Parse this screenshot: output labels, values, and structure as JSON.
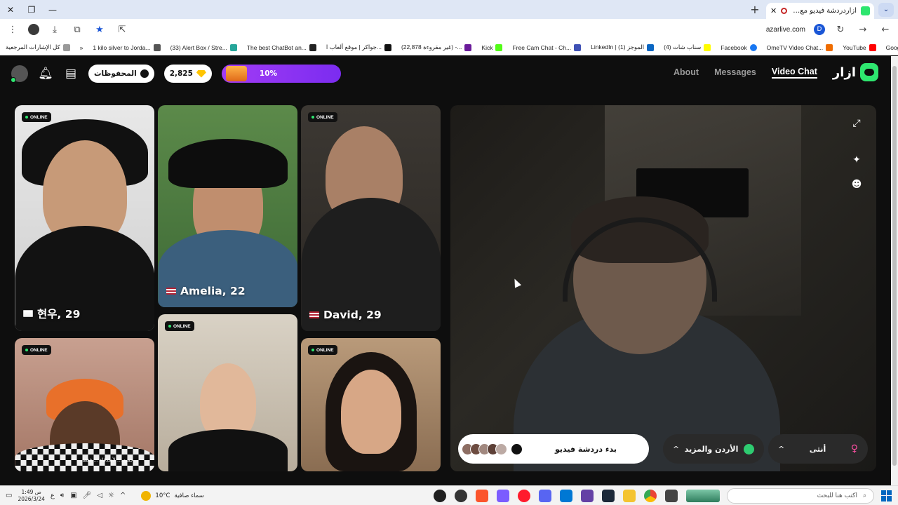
{
  "browser": {
    "window_controls": {
      "minimize": "—",
      "maximize": "❐",
      "close": "✕"
    },
    "new_tab": "+",
    "tab": {
      "title": "أزاردردشة فيديو مع أشخاص",
      "close": "✕"
    },
    "url": "azarlive.com",
    "profile_letter": "D",
    "bookmarks": [
      {
        "label": "كل الإشارات المرجعية"
      },
      {
        "label": "»"
      },
      {
        "label": "1 kilo silver to Jorda..."
      },
      {
        "label": "(33) Alert Box / Stre..."
      },
      {
        "label": "The best ChatBot an..."
      },
      {
        "label": "جواكر | موقع ألعاب ا..."
      },
      {
        "label": "(22,878 غير مقروءة) -..."
      },
      {
        "label": "Kick"
      },
      {
        "label": "Free Cam Chat - Ch..."
      },
      {
        "label": "LinkedIn | الموجز (1)"
      },
      {
        "label": "(4) سناب شات"
      },
      {
        "label": "Facebook"
      },
      {
        "label": "OmeTV Video Chat..."
      },
      {
        "label": "YouTube"
      },
      {
        "label": "Google"
      }
    ]
  },
  "header": {
    "saved_label": "المحفوظات",
    "gems": "2,825",
    "promo_percent": "10%",
    "nav": {
      "about": "About",
      "messages": "Messages",
      "video_chat": "Video Chat"
    },
    "brand": "ازار"
  },
  "cards": [
    {
      "status": "ONLINE",
      "name": "현우, 29",
      "flag": "kr"
    },
    {
      "status": "",
      "name": "Amelia, 22",
      "flag": "us"
    },
    {
      "status": "ONLINE",
      "name": "David, 29",
      "flag": "us"
    },
    {
      "status": "ONLINE",
      "name": "",
      "caption": "جميع ... لأصدقاء ... فقط"
    },
    {
      "status": "ONLINE",
      "name": ""
    },
    {
      "status": "ONLINE",
      "name": ""
    }
  ],
  "controls": {
    "start_label": "بدء دردشة فيديو",
    "region_label": "الأردن والمزيد",
    "gender_label": "أنثى",
    "chevron": "^"
  },
  "taskbar": {
    "time": "1:49 ص",
    "date": "2026/3/24",
    "lang": "ع",
    "weather_temp": "10°C",
    "weather_desc": "سماء صافية",
    "search_placeholder": "اكتب هنا للبحث"
  },
  "colors": {
    "accent_green": "#2ee66f",
    "promo_purple": "#8f34f3",
    "gem_gold": "#ffc400",
    "female_pink": "#ff4fa3"
  }
}
